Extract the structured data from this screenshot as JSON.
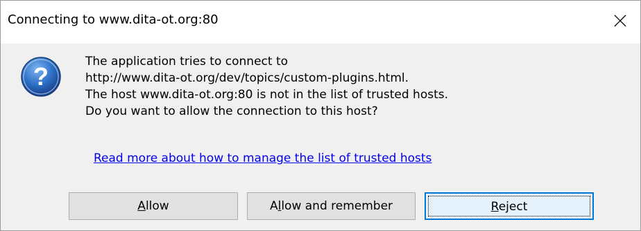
{
  "window": {
    "title": "Connecting to www.dita-ot.org:80",
    "close_icon": "close-icon"
  },
  "icon": {
    "name": "question-icon",
    "glyph": "?",
    "color": "#1e63b5"
  },
  "message": {
    "lines": [
      "The application tries to connect to",
      "http://www.dita-ot.org/dev/topics/custom-plugins.html.",
      "The host www.dita-ot.org:80 is not in the list of trusted hosts.",
      "Do you want to allow the connection to this host?"
    ]
  },
  "link": {
    "text": "Read more about how to manage the list of trusted hosts"
  },
  "buttons": {
    "allow": {
      "prefix": "",
      "mnemonic": "A",
      "rest": "llow"
    },
    "allow_remember": {
      "prefix": "A",
      "mnemonic": "l",
      "rest": "low and remember"
    },
    "reject": {
      "prefix": "",
      "mnemonic": "R",
      "rest": "eject"
    }
  },
  "colors": {
    "link": "#0000ee",
    "focus_border": "#0078d7",
    "body_bg": "#f0f0f0"
  }
}
